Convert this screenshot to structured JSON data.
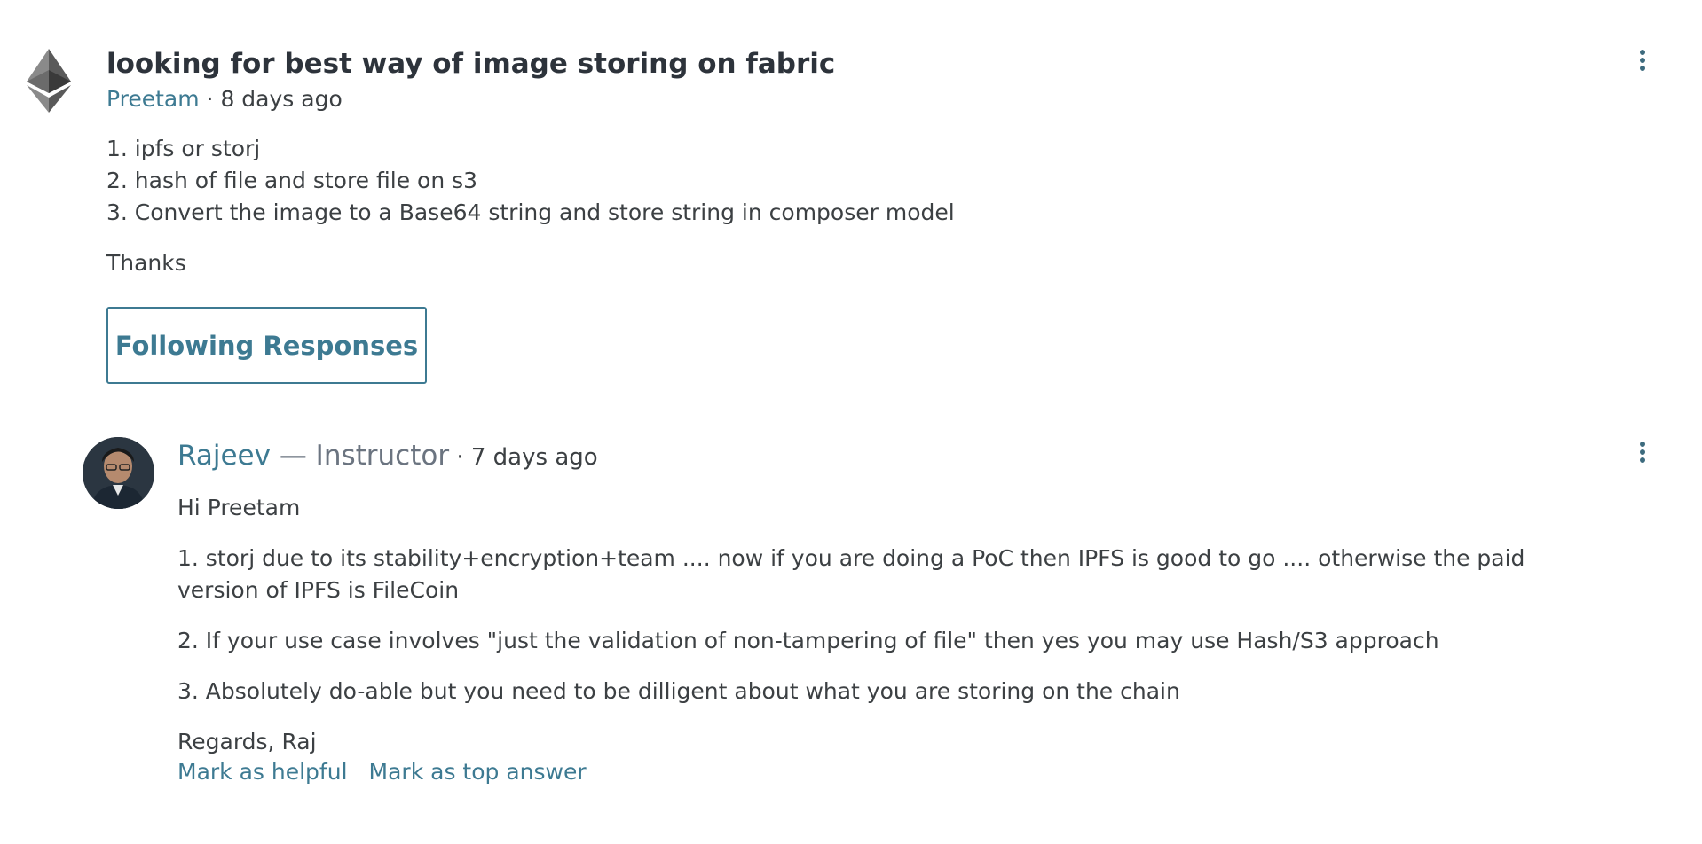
{
  "question": {
    "title": "looking for best way of image storing on fabric",
    "author": "Preetam",
    "separator": " · ",
    "time": "8 days ago",
    "lines": [
      "1. ipfs or storj",
      "2. hash of file and  store file on s3",
      "3. Convert the image to a Base64 string and store string in composer model"
    ],
    "closing": "Thanks",
    "follow_label": "Following Responses",
    "avatar_icon": "ethereum-logo-icon",
    "menu_icon": "more-vertical-icon"
  },
  "answer": {
    "author": "Rajeev",
    "role": " — Instructor",
    "separator": " · ",
    "time": "7 days ago",
    "greeting": "Hi Preetam",
    "paragraphs": [
      "1. storj due to its stability+encryption+team .... now if you are doing a PoC then IPFS is good to go .... otherwise the paid version of IPFS is FileCoin",
      "2. If your use case involves \"just the validation of non-tampering of file\" then yes you may use Hash/S3 approach",
      "3. Absolutely do-able but you need to be dilligent about what you are storing on the chain"
    ],
    "signoff": "Regards, Raj",
    "actions": {
      "helpful": "Mark as helpful",
      "top_answer": "Mark as top answer"
    },
    "menu_icon": "more-vertical-icon"
  },
  "colors": {
    "link": "#3d7a92",
    "text": "#3c4043",
    "title": "#2d333b",
    "muted": "#6b7480"
  }
}
